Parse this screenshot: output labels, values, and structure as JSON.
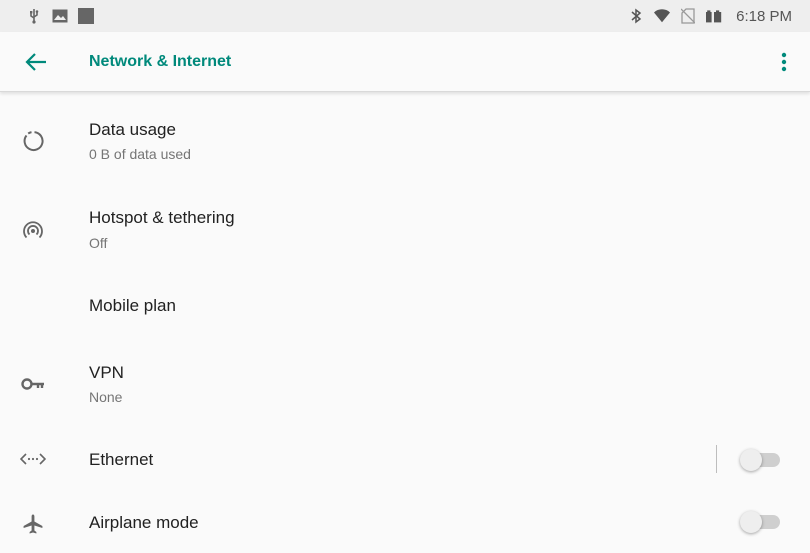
{
  "status_bar": {
    "left_icons": [
      "usb-icon",
      "image-icon",
      "notification-square-icon"
    ],
    "right_icons": [
      "bluetooth-icon",
      "wifi-icon",
      "no-sim-icon",
      "battery-icon"
    ],
    "time": "6:18 PM"
  },
  "app_bar": {
    "title": "Network & Internet",
    "accent_color": "#00897b"
  },
  "items": [
    {
      "title": "Data usage",
      "subtitle": "0 B of data used",
      "icon": "data-usage-icon"
    },
    {
      "title": "Hotspot & tethering",
      "subtitle": "Off",
      "icon": "hotspot-icon"
    },
    {
      "title": "Mobile plan",
      "subtitle": "",
      "icon": ""
    },
    {
      "title": "VPN",
      "subtitle": "None",
      "icon": "vpn-key-icon"
    },
    {
      "title": "Ethernet",
      "subtitle": "",
      "icon": "ethernet-icon",
      "toggle": false
    },
    {
      "title": "Airplane mode",
      "subtitle": "",
      "icon": "airplane-icon",
      "toggle": false
    }
  ]
}
